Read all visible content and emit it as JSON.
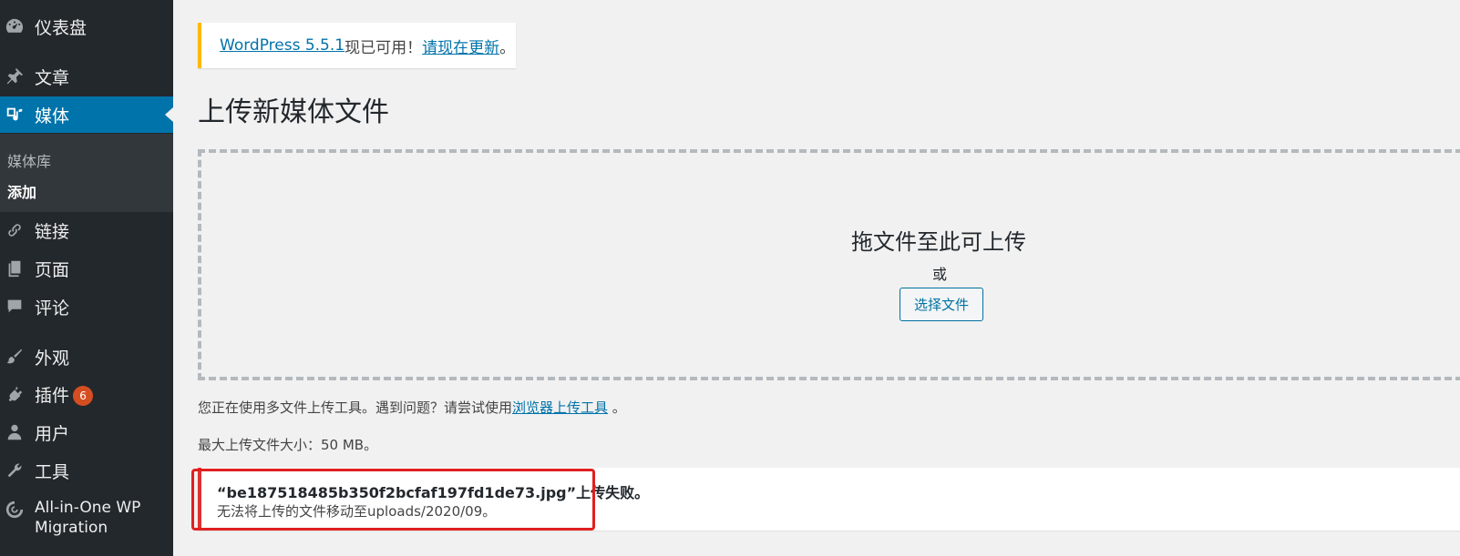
{
  "sidebar": {
    "items": [
      {
        "key": "dashboard",
        "label": "仪表盘",
        "icon": "dashboard-icon"
      },
      {
        "key": "posts",
        "label": "文章",
        "icon": "pin-icon"
      },
      {
        "key": "media",
        "label": "媒体",
        "icon": "media-icon"
      },
      {
        "key": "links",
        "label": "链接",
        "icon": "link-icon"
      },
      {
        "key": "pages",
        "label": "页面",
        "icon": "pages-icon"
      },
      {
        "key": "comments",
        "label": "评论",
        "icon": "comment-icon"
      },
      {
        "key": "appearance",
        "label": "外观",
        "icon": "brush-icon"
      },
      {
        "key": "plugins",
        "label": "插件",
        "icon": "plugin-icon",
        "badge": "6"
      },
      {
        "key": "users",
        "label": "用户",
        "icon": "user-icon"
      },
      {
        "key": "tools",
        "label": "工具",
        "icon": "wrench-icon"
      },
      {
        "key": "all_in_one",
        "label_line1": "All-in-One WP",
        "label_line2": "Migration",
        "icon": "migration-icon"
      }
    ],
    "submenu": [
      {
        "label": "媒体库"
      },
      {
        "label": "添加"
      }
    ],
    "active": "media"
  },
  "notice": {
    "link1": "WordPress 5.5.1",
    "text_mid": "现已可用！",
    "link2": "请现在更新",
    "text_end": "。"
  },
  "page": {
    "title": "上传新媒体文件"
  },
  "dropzone": {
    "instructions": "拖文件至此可上传",
    "or": "或",
    "button": "选择文件"
  },
  "uploader_note": {
    "text": "您正在使用多文件上传工具。遇到问题？请尝试使用",
    "link": "浏览器上传工具",
    "end": " 。"
  },
  "max_size": "最大上传文件大小：50 MB。",
  "error": {
    "title": "“be187518485b350f2bcfaf197fd1de73.jpg”上传失败。",
    "detail": "无法将上传的文件移动至uploads/2020/09。"
  },
  "colors": {
    "sidebar_bg": "#23282d",
    "active_bg": "#0073aa",
    "notice_border": "#ffb900",
    "error_border": "#dc3232",
    "highlight": "#e02020",
    "badge": "#d54e21"
  }
}
